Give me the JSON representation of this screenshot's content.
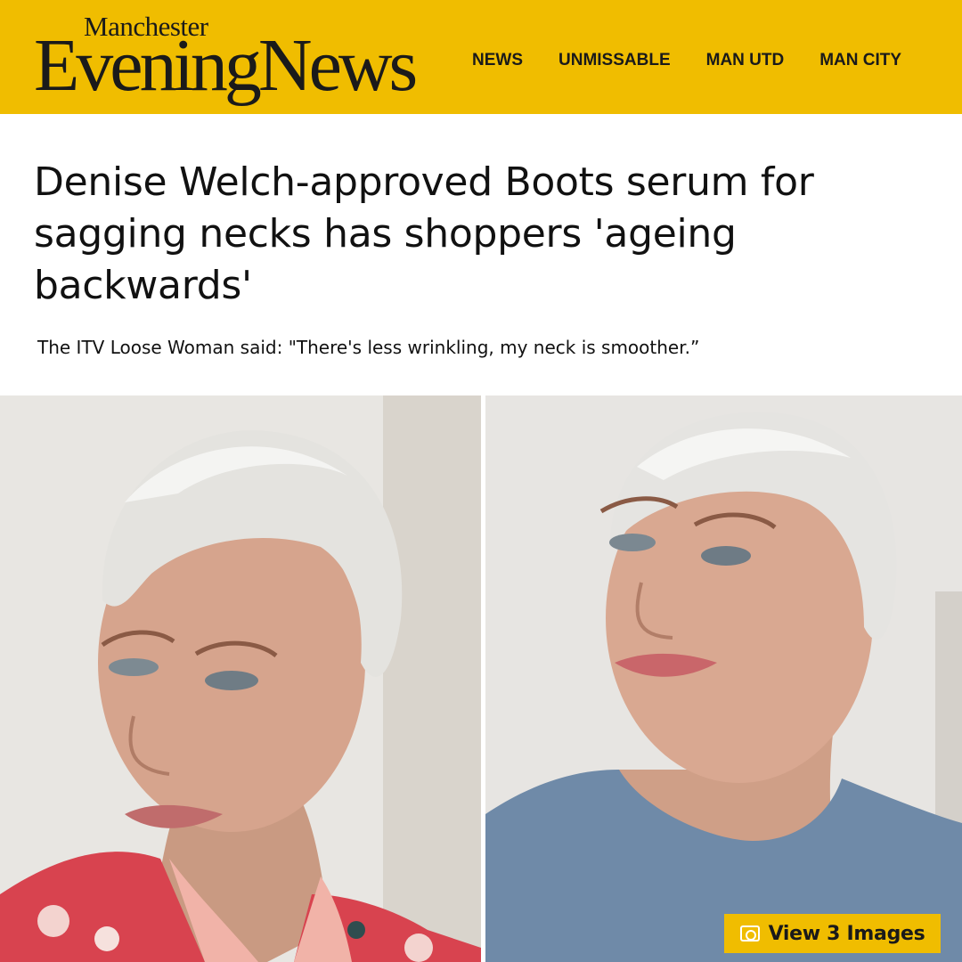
{
  "brand": {
    "top": "Manchester",
    "main": "EveningNews",
    "color": "#f0bd00"
  },
  "nav": [
    {
      "label": "NEWS"
    },
    {
      "label": "UNMISSABLE"
    },
    {
      "label": "MAN UTD"
    },
    {
      "label": "MAN CITY"
    }
  ],
  "article": {
    "headline": "Denise Welch-approved Boots serum for sagging necks has shoppers 'ageing backwards'",
    "standfirst": "The ITV Loose Woman said:  \"There's less wrinkling, my neck is smoother.”"
  },
  "gallery": {
    "button_label": "View 3 Images",
    "icon": "gallery-icon"
  }
}
